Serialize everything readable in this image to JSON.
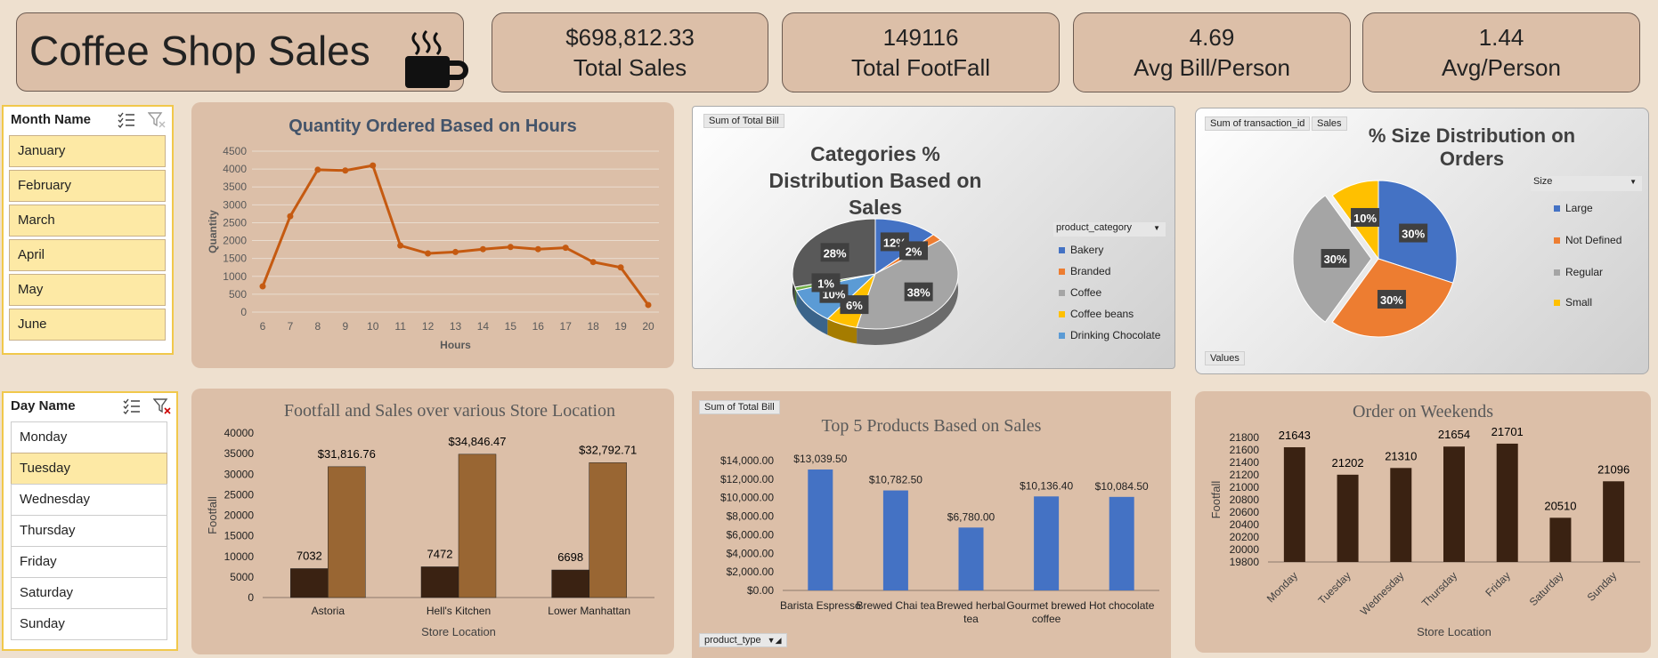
{
  "header": {
    "title": "Coffee Shop Sales",
    "icon": "coffee-cup-icon"
  },
  "kpis": [
    {
      "value": "$698,812.33",
      "label": "Total Sales"
    },
    {
      "value": "149116",
      "label": "Total FootFall"
    },
    {
      "value": "4.69",
      "label": "Avg Bill/Person"
    },
    {
      "value": "1.44",
      "label": "Avg/Person"
    }
  ],
  "month_slicer": {
    "header": "Month Name",
    "items": [
      "January",
      "February",
      "March",
      "April",
      "May",
      "June"
    ]
  },
  "day_slicer": {
    "header": "Day Name",
    "items": [
      "Monday",
      "Tuesday",
      "Wednesday",
      "Thursday",
      "Friday",
      "Saturday",
      "Sunday"
    ],
    "selected": "Tuesday"
  },
  "pivot": {
    "sum_total_bill": "Sum of Total Bill",
    "sum_transaction_id": "Sum of transaction_id",
    "sales": "Sales",
    "values": "Values",
    "product_category": "product_category",
    "size": "Size",
    "product_type": "product_type"
  },
  "colors": {
    "panel": "#dcbfa8",
    "line": "#c55a11",
    "dark_bar": "#3a2212",
    "brown_bar": "#996633",
    "blue": "#4472c4",
    "orange": "#ed7d31",
    "gray": "#a5a5a5",
    "gold": "#ffc000",
    "lightblue": "#5b9bd5",
    "green": "#70ad47",
    "darkgray": "#595959"
  },
  "chart_data": [
    {
      "type": "line",
      "title": "Quantity Ordered Based on Hours",
      "xlabel": "Hours",
      "ylabel": "Quantity",
      "x": [
        6,
        7,
        8,
        9,
        10,
        11,
        12,
        13,
        14,
        15,
        16,
        17,
        18,
        19,
        20
      ],
      "values": [
        720,
        2680,
        3980,
        3960,
        4100,
        1860,
        1640,
        1680,
        1760,
        1820,
        1760,
        1800,
        1400,
        1250,
        200
      ],
      "ylim": [
        0,
        4500
      ],
      "yticks": [
        0,
        500,
        1000,
        1500,
        2000,
        2500,
        3000,
        3500,
        4000,
        4500
      ]
    },
    {
      "type": "pie",
      "title": "Categories % Distribution Based on Sales",
      "legend": [
        "Bakery",
        "Branded",
        "Coffee",
        "Coffee beans",
        "Drinking Chocolate"
      ],
      "slices": [
        {
          "label": "12%",
          "value": 12
        },
        {
          "label": "2%",
          "value": 2
        },
        {
          "label": "38%",
          "value": 38
        },
        {
          "label": "6%",
          "value": 6
        },
        {
          "label": "10%",
          "value": 10
        },
        {
          "label": "1%",
          "value": 1
        },
        {
          "label": "28%",
          "value": 28
        }
      ]
    },
    {
      "type": "pie",
      "title": "% Size Distribution on Orders",
      "legend": [
        "Large",
        "Not Defined",
        "Regular",
        "Small"
      ],
      "slices": [
        {
          "label": "30%",
          "value": 30
        },
        {
          "label": "30%",
          "value": 30
        },
        {
          "label": "30%",
          "value": 30
        },
        {
          "label": "10%",
          "value": 10
        }
      ]
    },
    {
      "type": "bar",
      "title": "Footfall and Sales over various Store Location",
      "xlabel": "Store Location",
      "ylabel": "Footfall",
      "categories": [
        "Astoria",
        "Hell's Kitchen",
        "Lower Manhattan"
      ],
      "series": [
        {
          "values": [
            7032,
            7472,
            6698
          ],
          "labels": [
            "7032",
            "7472",
            "6698"
          ]
        },
        {
          "values": [
            31816.76,
            34846.47,
            32792.71
          ],
          "labels": [
            "$31,816.76",
            "$34,846.47",
            "$32,792.71"
          ]
        }
      ],
      "ylim": [
        0,
        40000
      ],
      "yticks": [
        "0",
        "5000",
        "10000",
        "15000",
        "20000",
        "25000",
        "30000",
        "35000",
        "40000"
      ]
    },
    {
      "type": "bar",
      "title": "Top 5 Products Based on Sales",
      "categories": [
        "Barista Espresso",
        "Brewed Chai tea",
        "Brewed herbal tea",
        "Gourmet brewed coffee",
        "Hot chocolate"
      ],
      "values": [
        13039.5,
        10782.5,
        6780.0,
        10136.4,
        10084.5
      ],
      "labels": [
        "$13,039.50",
        "$10,782.50",
        "$6,780.00",
        "$10,136.40",
        "$10,084.50"
      ],
      "ylim": [
        0,
        14000
      ],
      "yticks": [
        "$0.00",
        "$2,000.00",
        "$4,000.00",
        "$6,000.00",
        "$8,000.00",
        "$10,000.00",
        "$12,000.00",
        "$14,000.00"
      ]
    },
    {
      "type": "bar",
      "title": "Order on Weekends",
      "xlabel": "Store Location",
      "ylabel": "Footfall",
      "categories": [
        "Monday",
        "Tuesday",
        "Wednesday",
        "Thursday",
        "Friday",
        "Saturday",
        "Sunday"
      ],
      "values": [
        21643,
        21202,
        21310,
        21654,
        21701,
        20510,
        21096
      ],
      "ylim": [
        19800,
        21800
      ],
      "yticks": [
        "19800",
        "20000",
        "20200",
        "20400",
        "20600",
        "20800",
        "21000",
        "21200",
        "21400",
        "21600",
        "21800"
      ]
    }
  ]
}
